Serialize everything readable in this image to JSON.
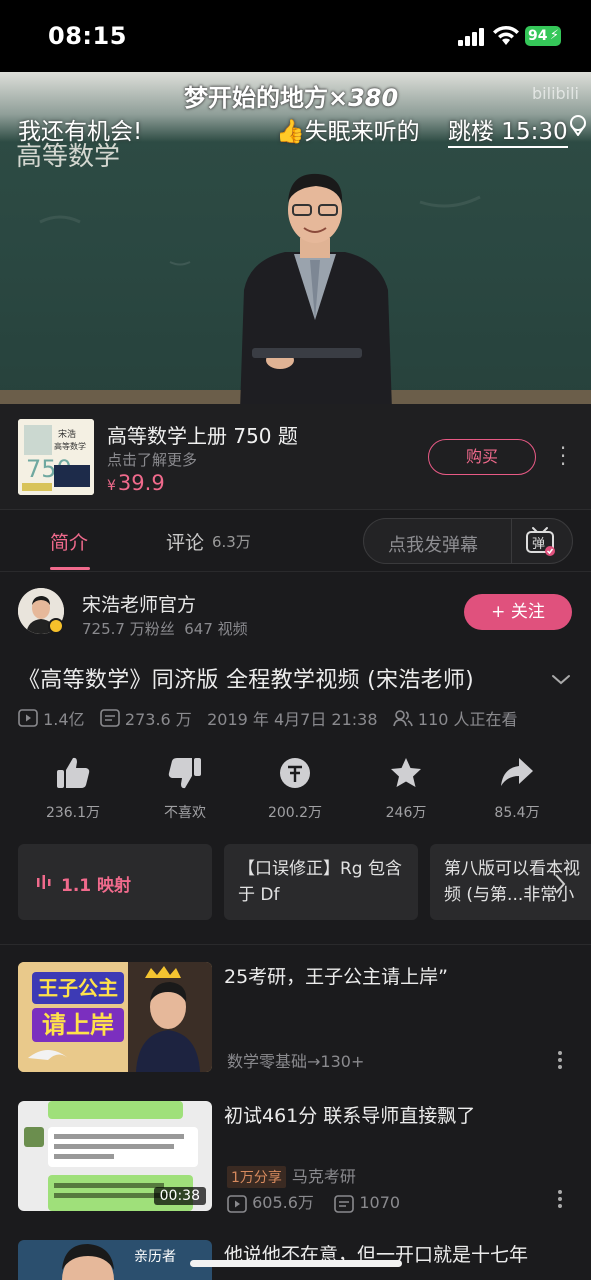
{
  "status_bar": {
    "time": "08:15",
    "battery": "94"
  },
  "video": {
    "danmaku_top": "梦开始的地方",
    "danmaku_top_mult": "×380",
    "danmaku_left": "我还有机会!",
    "danmaku_mid": "失眠来听的",
    "jump_label": "跳楼 15:30",
    "chalk_title": "高等数学",
    "watermark": "bilibili"
  },
  "ad": {
    "title": "高等数学上册 750 题",
    "subtitle": "点击了解更多",
    "currency": "¥",
    "price": "39.9",
    "buy_label": "购买",
    "thumb_text": "宋浩 高等数学 750"
  },
  "tabs": {
    "intro_label": "简介",
    "comment_label": "评论",
    "comment_count": "6.3万",
    "danmaku_placeholder": "点我发弹幕",
    "danmaku_icon_label": "弹"
  },
  "uploader": {
    "name": "宋浩老师官方",
    "followers": "725.7 万粉丝",
    "videos": "647 视频",
    "follow_label": "+ 关注"
  },
  "video_info": {
    "title": "《高等数学》同济版 全程教学视频 (宋浩老师)",
    "plays": "1.4亿",
    "danmaku": "273.6 万",
    "date": "2019 年 4月7日 21:38",
    "watching": "110 人正在看"
  },
  "actions": [
    {
      "icon": "thumbs-up-icon",
      "label": "236.1万"
    },
    {
      "icon": "thumbs-down-icon",
      "label": "不喜欢"
    },
    {
      "icon": "coin-icon",
      "label": "200.2万"
    },
    {
      "icon": "star-icon",
      "label": "246万"
    },
    {
      "icon": "share-icon",
      "label": "85.4万"
    }
  ],
  "chips": {
    "map_label": "1.1 映射",
    "fix_text": "【口误修正】Rg 包含于 Df",
    "ver_text": "第八版可以看本视频 (与第...非常小"
  },
  "recommendations": [
    {
      "title": "25考研，王子公主请上岸”",
      "thumb_line1": "王子公主",
      "thumb_line2": "请上岸",
      "meta": "数学零基础→130+"
    },
    {
      "title": "初试461分  联系导师直接飘了",
      "tag": "1万分享",
      "author": "马克考研",
      "plays": "605.6万",
      "comments": "1070",
      "duration": "00:38"
    },
    {
      "title": "他说他不在意，但一开口就是十七年",
      "thumb_text": "亲历者"
    }
  ],
  "colors": {
    "accent": "#e0517d",
    "background": "#1b1b1d"
  }
}
